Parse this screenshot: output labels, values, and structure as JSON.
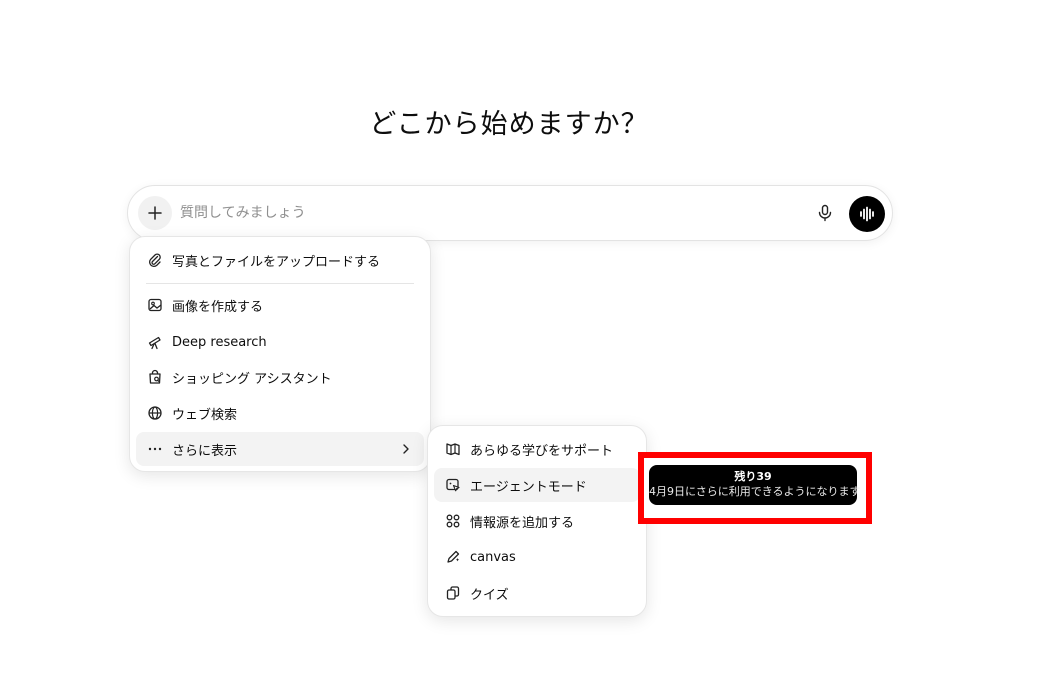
{
  "headline": "どこから始めますか？",
  "composer": {
    "placeholder": "質問してみましょう"
  },
  "main_menu": {
    "items": [
      {
        "label": "写真とファイルをアップロードする",
        "icon": "paperclip-icon"
      },
      {
        "label": "画像を作成する",
        "icon": "image-icon"
      },
      {
        "label": "Deep research",
        "icon": "telescope-icon"
      },
      {
        "label": "ショッピング アシスタント",
        "icon": "shopping-bag-icon"
      },
      {
        "label": "ウェブ検索",
        "icon": "globe-icon"
      },
      {
        "label": "さらに表示",
        "icon": "more-icon"
      }
    ]
  },
  "sub_menu": {
    "items": [
      {
        "label": "あらゆる学びをサポート",
        "icon": "book-icon"
      },
      {
        "label": "エージェントモード",
        "icon": "agent-icon"
      },
      {
        "label": "情報源を追加する",
        "icon": "connectors-icon"
      },
      {
        "label": "canvas",
        "icon": "pen-icon"
      },
      {
        "label": "クイズ",
        "icon": "cards-icon"
      }
    ]
  },
  "tooltip": {
    "title": "残り39",
    "body": "4月9日にさらに利用できるようになります"
  },
  "colors": {
    "highlight": "#ff0000",
    "tooltip_bg": "#000000",
    "hover_bg": "#f3f3f3"
  }
}
